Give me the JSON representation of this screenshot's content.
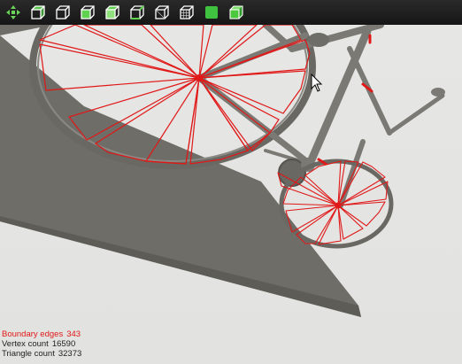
{
  "toolbar": {
    "buttons": [
      {
        "id": "move-tool",
        "icon": "move-arrows-icon"
      },
      {
        "id": "view-cube-1",
        "icon": "wireframe-cube-green-icon"
      },
      {
        "id": "view-cube-2",
        "icon": "wireframe-cube-icon"
      },
      {
        "id": "view-cube-3",
        "icon": "green-face-cube-icon"
      },
      {
        "id": "view-cube-4",
        "icon": "green-face-cube-icon"
      },
      {
        "id": "view-cube-5",
        "icon": "green-edge-cube-icon"
      },
      {
        "id": "view-cube-6",
        "icon": "wireframe-cube-icon"
      },
      {
        "id": "view-cube-7",
        "icon": "grid-cube-icon"
      },
      {
        "id": "solid-view",
        "icon": "solid-green-square-icon"
      },
      {
        "id": "shaded-cube",
        "icon": "shaded-green-cube-icon"
      }
    ]
  },
  "colors": {
    "boundary": "#e01818",
    "accent": "#3fc23f",
    "background": "#e4e4e2",
    "model": "#6f6d67"
  },
  "stats": {
    "boundary_label": "Boundary edges",
    "boundary_value": "343",
    "vertex_label": "Vertex count",
    "vertex_value": "16590",
    "triangle_label": "Triangle count",
    "triangle_value": "32373"
  }
}
